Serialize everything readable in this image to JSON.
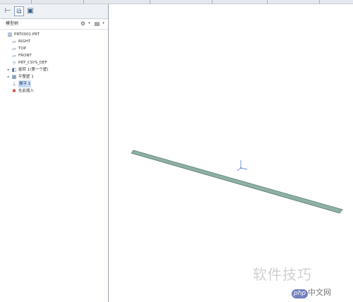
{
  "colors": {
    "part_fill": "#8fb0a3",
    "part_edge": "#5d7f72",
    "selection": "#c9dcf3",
    "axis_blue": "#3a6fd0"
  },
  "panel_tabs": [
    {
      "icon": "model-tree-tab-icon",
      "glyph": "⊢",
      "active": false
    },
    {
      "icon": "layers-tab-icon",
      "glyph": "⧉",
      "active": true
    },
    {
      "icon": "folder-tab-icon",
      "glyph": "▣",
      "active": false
    }
  ],
  "tree_header": {
    "title": "模型树",
    "settings_icon": "tree-settings-icon",
    "show_icon": "tree-show-icon"
  },
  "tree": [
    {
      "name": "tree-item-part",
      "icon": "part-icon",
      "glyph": "▥",
      "label": "PRT0001.PRT",
      "indent": 0,
      "expander": "",
      "selected": false
    },
    {
      "name": "tree-item-right",
      "icon": "datum-plane-icon",
      "glyph": "▱",
      "label": "RIGHT",
      "indent": 1,
      "expander": "",
      "selected": false
    },
    {
      "name": "tree-item-top",
      "icon": "datum-plane-icon",
      "glyph": "▱",
      "label": "TOP",
      "indent": 1,
      "expander": "",
      "selected": false
    },
    {
      "name": "tree-item-front",
      "icon": "datum-plane-icon",
      "glyph": "▱",
      "label": "FRONT",
      "indent": 1,
      "expander": "",
      "selected": false
    },
    {
      "name": "tree-item-csys",
      "icon": "csys-icon",
      "glyph": "⊹",
      "label": "PRT_CSYS_DEF",
      "indent": 1,
      "expander": "",
      "selected": false
    },
    {
      "name": "tree-item-sheetmetal",
      "icon": "sheetmetal-icon",
      "glyph": "◧",
      "label": "旋转 1(第一个壁)",
      "indent": 1,
      "expander": "▸",
      "selected": false
    },
    {
      "name": "tree-item-flat",
      "icon": "flat-wall-icon",
      "glyph": "▦",
      "label": "平整壁 1",
      "indent": 1,
      "expander": "▸",
      "selected": false
    },
    {
      "name": "tree-item-unbend",
      "icon": "unbend-icon",
      "glyph": "⊥",
      "label": "展平 1",
      "indent": 1,
      "expander": "",
      "selected": true
    },
    {
      "name": "tree-item-insert-here",
      "icon": "insert-here-icon",
      "glyph": "✱",
      "label": "在此插入",
      "indent": 1,
      "expander": "",
      "selected": false,
      "red": true
    }
  ],
  "watermark": "软件技巧",
  "logo": {
    "badge": "php",
    "text": "中文网"
  }
}
